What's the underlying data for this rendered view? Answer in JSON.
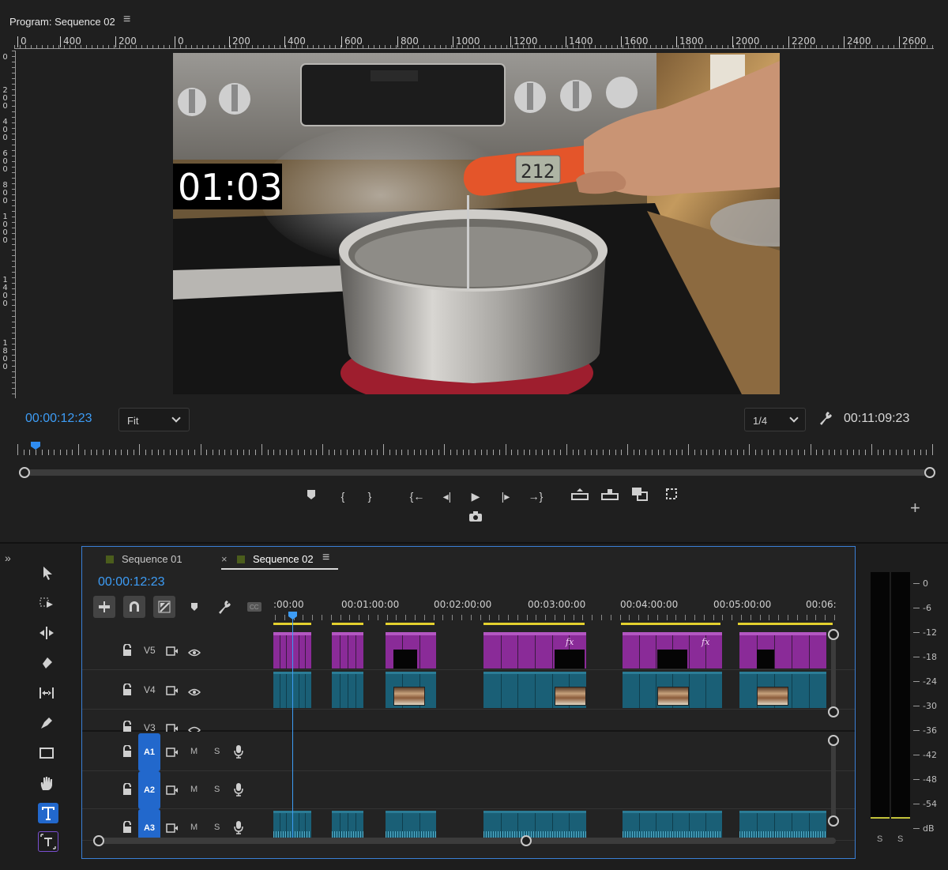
{
  "program": {
    "title": "Program: Sequence 02",
    "menu_icon": "hamburger-icon",
    "ruler_labels": [
      "0",
      "400",
      "200",
      "0",
      "200",
      "400",
      "600",
      "800",
      "1000",
      "1200",
      "1400",
      "1600",
      "1800",
      "2000",
      "2200",
      "2400",
      "2600"
    ],
    "vruler_labels": [
      "0",
      "200",
      "400",
      "600",
      "800",
      "1000",
      "1400",
      "1800"
    ],
    "overlay_timer": "01:03",
    "thermometer_reading": "212",
    "timecode_current": "00:00:12:23",
    "fit_label": "Fit",
    "resolution_label": "1/4",
    "timecode_duration": "00:11:09:23",
    "transport": [
      "add-marker",
      "mark-in",
      "mark-out",
      "go-to-in",
      "step-back",
      "play",
      "step-forward",
      "go-to-out",
      "lift",
      "extract",
      "overwrite",
      "vr-video",
      "export-frame"
    ]
  },
  "timeline": {
    "tabs": [
      {
        "label": "Sequence 01",
        "color": "#4b5d1c"
      },
      {
        "label": "Sequence 02",
        "color": "#4b5d1c"
      }
    ],
    "close_glyph": "×",
    "timecode": "00:00:12:23",
    "ruler_labels": [
      ":00:00",
      "00:01:00:00",
      "00:02:00:00",
      "00:03:00:00",
      "00:04:00:00",
      "00:05:00:00",
      "00:06:"
    ],
    "tracks": {
      "v5": "V5",
      "v4": "V4",
      "v3": "V3",
      "a1": "A1",
      "a2": "A2",
      "a3": "A3",
      "mute": "M",
      "solo": "S"
    },
    "fx_label": "fx"
  },
  "meter": {
    "scale": [
      "0",
      "-6",
      "-12",
      "-18",
      "-24",
      "-30",
      "-36",
      "-42",
      "-48",
      "-54",
      "dB"
    ],
    "channels": [
      "S",
      "S"
    ]
  },
  "colors": {
    "accent": "#3d9cf5",
    "video_clip": "#8a2b98",
    "audio_clip": "#1a5f76",
    "in_out_bar": "#e4d12e"
  }
}
